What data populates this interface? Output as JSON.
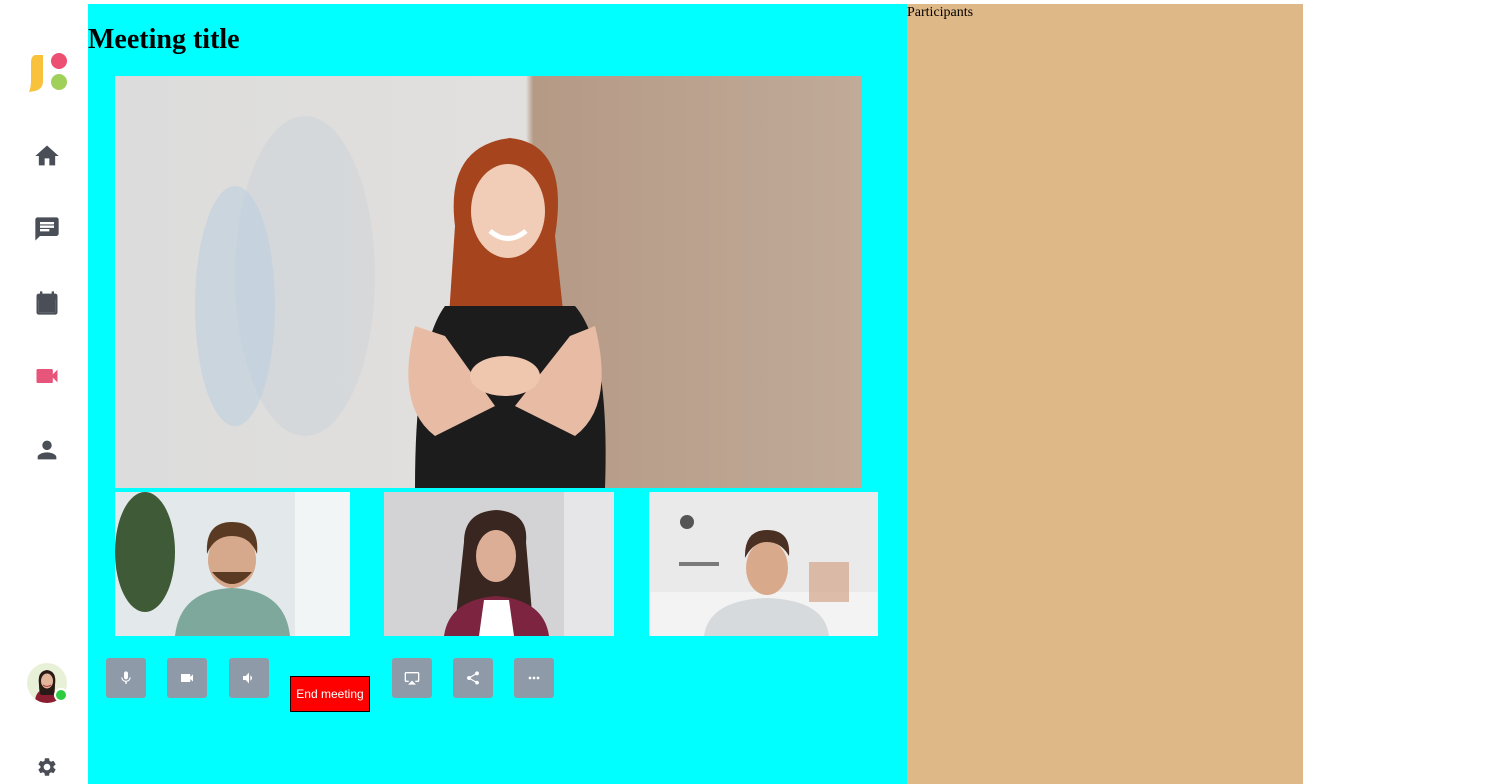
{
  "meeting": {
    "title": "Meeting title",
    "end_label": "End meeting"
  },
  "participants_panel": {
    "title": "Participants"
  },
  "colors": {
    "main_bg": "#00ffff",
    "participants_bg": "#deb887",
    "end_button": "#ff0000",
    "control_button": "#8f9aa8",
    "nav_icon": "#4a4f57",
    "nav_icon_active": "#e8557a",
    "online": "#2ecc40"
  },
  "sidebar": {
    "items": [
      {
        "icon": "home-icon"
      },
      {
        "icon": "chat-icon"
      },
      {
        "icon": "calendar-icon"
      },
      {
        "icon": "video-icon",
        "active": true
      },
      {
        "icon": "person-icon"
      }
    ]
  },
  "controls": [
    {
      "icon": "microphone-icon"
    },
    {
      "icon": "camera-icon"
    },
    {
      "icon": "speaker-icon"
    },
    {
      "icon": "screen-cast-icon"
    },
    {
      "icon": "share-icon"
    },
    {
      "icon": "more-icon"
    }
  ]
}
